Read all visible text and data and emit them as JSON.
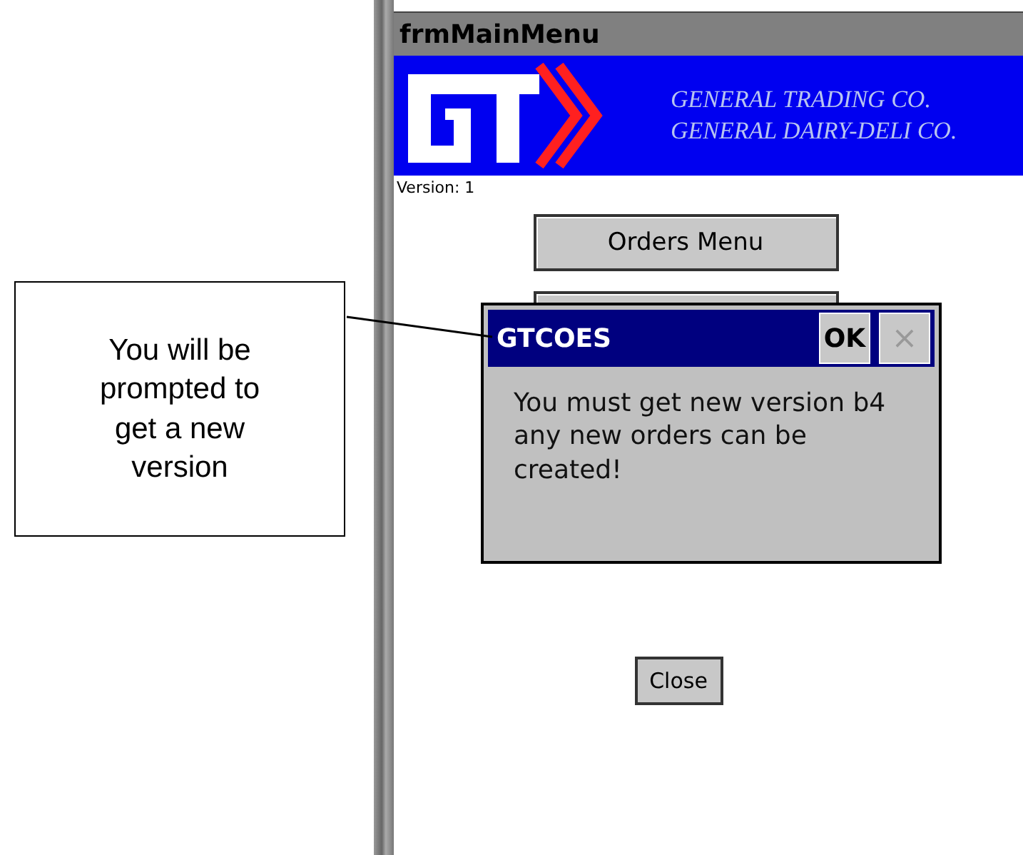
{
  "callout": {
    "text": "You will be prompted to get a new version"
  },
  "window": {
    "title": "frmMainMenu"
  },
  "banner": {
    "lines": [
      "GENERAL TRADING CO.",
      "GENERAL DAIRY-DELI CO."
    ]
  },
  "version_label": "Version: 1",
  "menu_buttons": [
    {
      "label": "Orders Menu"
    }
  ],
  "dialog": {
    "title": "GTCOES",
    "ok": "OK",
    "close": "×",
    "message": "You must get new version b4 any new orders can be created!"
  },
  "close_button": "Close"
}
